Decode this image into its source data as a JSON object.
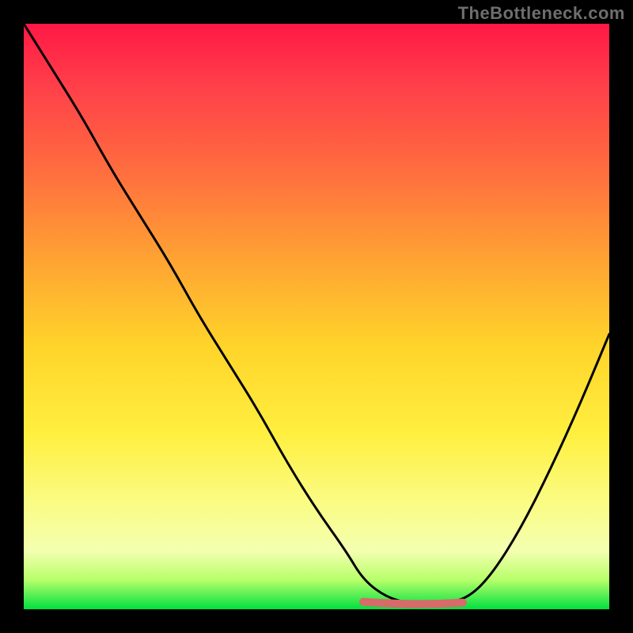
{
  "watermark": "TheBottleneck.com",
  "colors": {
    "page_bg": "#000000",
    "watermark_text": "#6e6e6e",
    "curve_stroke": "#000000",
    "accent_stroke": "#d86a6a",
    "gradient_top": "#ff1845",
    "gradient_bottom": "#00e040"
  },
  "chart_data": {
    "type": "line",
    "title": "",
    "xlabel": "",
    "ylabel": "",
    "xlim": [
      0,
      100
    ],
    "ylim": [
      0,
      100
    ],
    "grid": false,
    "series": [
      {
        "name": "bottleneck-curve",
        "x": [
          0,
          5,
          10,
          15,
          20,
          25,
          30,
          35,
          40,
          45,
          50,
          55,
          58,
          62,
          66,
          70,
          72,
          76,
          80,
          85,
          90,
          95,
          100
        ],
        "values": [
          100,
          92,
          84,
          75,
          67,
          59,
          50,
          42,
          34,
          25,
          17,
          10,
          5,
          2,
          1,
          1,
          1,
          2,
          6,
          14,
          24,
          35,
          47
        ]
      }
    ],
    "annotations": [
      {
        "name": "flat-bottom-highlight",
        "x_range": [
          58,
          75
        ],
        "y": 1,
        "color": "#d86a6a"
      }
    ]
  }
}
